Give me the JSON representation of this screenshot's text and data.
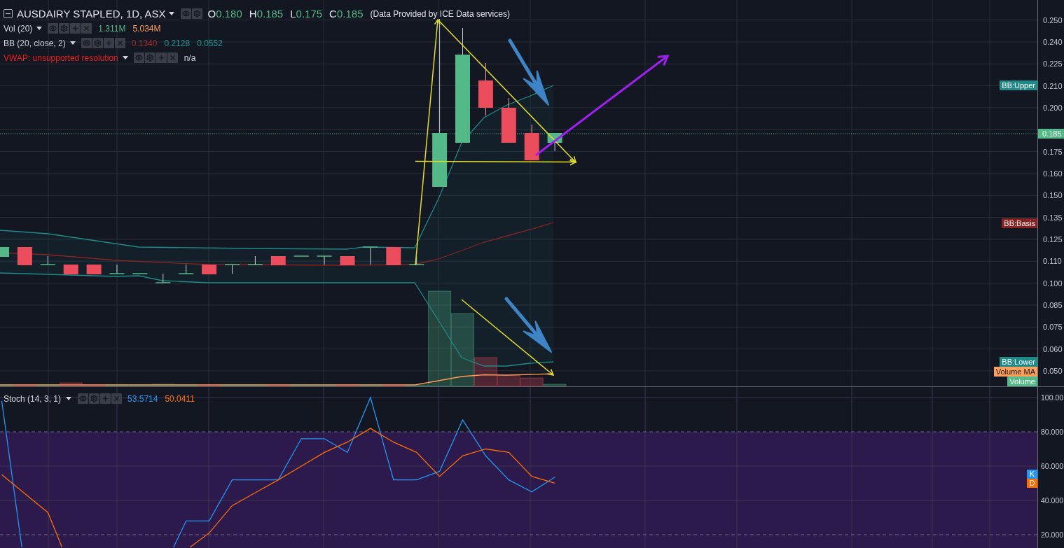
{
  "header": {
    "symbol": "AUSDAIRY STAPLED, 1D, ASX",
    "ohlc": [
      {
        "label": "O",
        "value": "0.180"
      },
      {
        "label": "H",
        "value": "0.185"
      },
      {
        "label": "L",
        "value": "0.175"
      },
      {
        "label": "C",
        "value": "0.185"
      }
    ],
    "note": "(Data Provided by ICE Data services)"
  },
  "indicators": [
    {
      "name": "Vol (20)",
      "error": false,
      "values": [
        {
          "text": "1.311M",
          "color": "#53b987"
        },
        {
          "text": "5.034M",
          "color": "#ff9a52"
        }
      ]
    },
    {
      "name": "BB (20, close, 2)",
      "error": false,
      "values": [
        {
          "text": "0.1340",
          "color": "#9b2c2c"
        },
        {
          "text": "0.2128",
          "color": "#1e9b98"
        },
        {
          "text": "0.0552",
          "color": "#1e9b98"
        }
      ]
    },
    {
      "name": "VWAP: unsupported resolution",
      "error": true,
      "values": [
        {
          "text": "n/a",
          "color": "#d1d4dc"
        }
      ]
    }
  ],
  "price_axis": {
    "ticks": [
      "0.250",
      "0.240",
      "0.225",
      "0.210",
      "0.200",
      "0.175",
      "0.160",
      "0.150",
      "0.135",
      "0.125",
      "0.110",
      "0.100",
      "0.085",
      "0.075",
      "0.060",
      "0.050"
    ],
    "last_price": "0.185"
  },
  "series_tags": [
    {
      "text": "BB:Upper",
      "color": "#1e8b89"
    },
    {
      "text": "BB:Basis",
      "color": "#872323"
    },
    {
      "text": "BB:Lower",
      "color": "#1e8b89"
    },
    {
      "text": "Volume MA",
      "color": "#ffa05a"
    },
    {
      "text": "Volume",
      "color": "#53b987"
    }
  ],
  "stoch": {
    "name": "Stoch (14, 3, 1)",
    "readings": [
      {
        "text": "53.5714",
        "color": "#2196f3"
      },
      {
        "text": "50.0411",
        "color": "#ff6d00"
      }
    ],
    "axis_ticks": [
      "100.00",
      "80.000",
      "60.000",
      "40.000",
      "20.000"
    ],
    "tags": [
      {
        "text": "K",
        "color": "#2196f3"
      },
      {
        "text": "D",
        "color": "#ff6d00"
      }
    ]
  }
}
